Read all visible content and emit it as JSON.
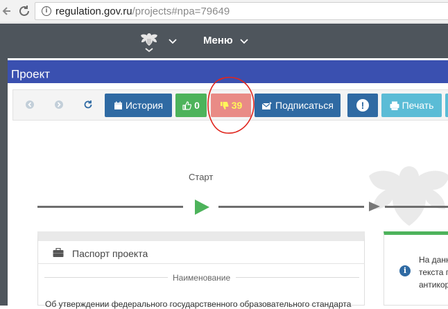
{
  "browser": {
    "url_host": "regulation.gov.ru",
    "url_path": "/projects#npa=79649"
  },
  "header": {
    "menu_label": "Меню"
  },
  "page": {
    "title": "Проект"
  },
  "toolbar": {
    "history_label": "История",
    "like_count": "0",
    "dislike_count": "39",
    "subscribe_label": "Подписаться",
    "alert_label": "!",
    "print_label": "Печать"
  },
  "timeline": {
    "start_label": "Старт"
  },
  "passport": {
    "title": "Паспорт проекта",
    "field_label": "Наименование",
    "field_value": "Об утверждении федерального государственного образовательного стандарта"
  },
  "info_card": {
    "line1": "На данн",
    "line2": "текста п",
    "line3": "антикор"
  },
  "colors": {
    "header_bg": "#4e555c",
    "title_bar": "#3a50b0",
    "primary_button": "#2f6aa3",
    "like_button": "#4db35b",
    "dislike_button": "#e98b86",
    "print_button": "#5bbcd6",
    "annotation": "#e0261e"
  }
}
